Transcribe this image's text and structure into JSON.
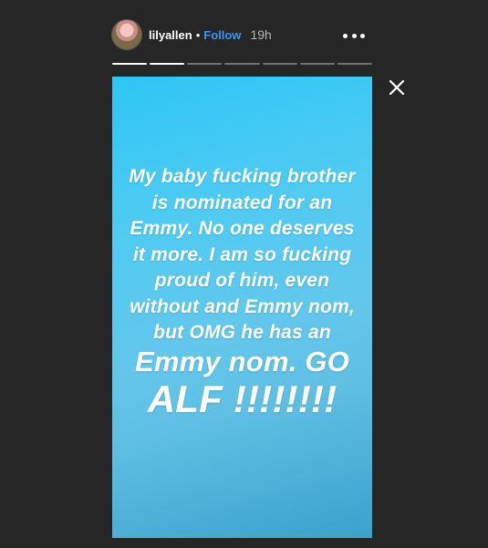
{
  "header": {
    "username": "lilyallen",
    "separator": "•",
    "follow_label": "Follow",
    "timestamp": "19h",
    "more_icon": "more-horizontal-icon",
    "avatar_icon": "avatar"
  },
  "progress": {
    "total_segments": 7,
    "completed_segments": 2
  },
  "close_icon": "close-icon",
  "story": {
    "lines": [
      "My baby fucking brother",
      "is nominated for an",
      "Emmy. No one deserves",
      "it more. I am so fucking",
      "proud of him, even",
      "without and Emmy nom,",
      "but OMG  he has an"
    ],
    "line_big": "Emmy nom. GO",
    "line_huge": "ALF !!!!!!!!",
    "background_top": "#2ec6f5",
    "background_bottom": "#3aa2cc"
  }
}
